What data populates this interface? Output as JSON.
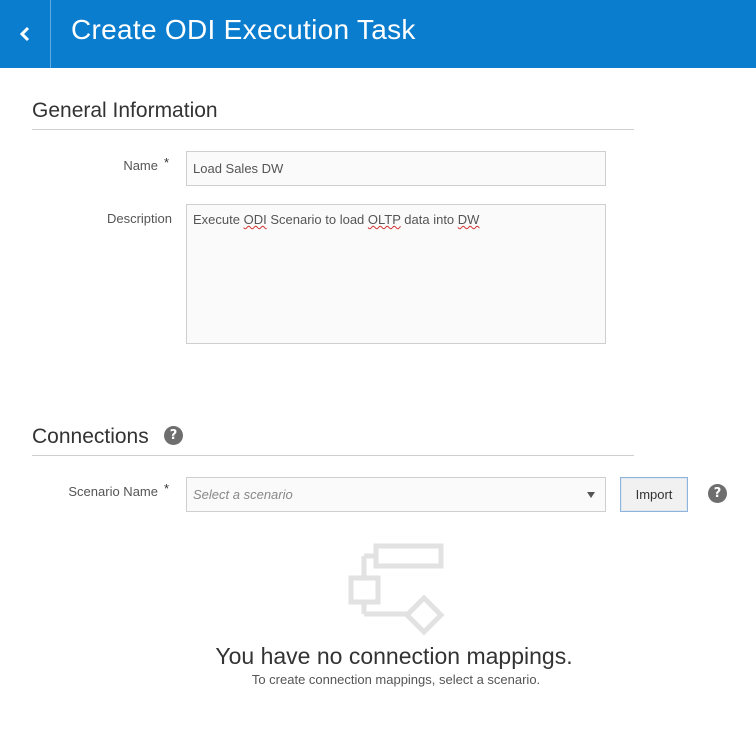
{
  "header": {
    "title": "Create ODI Execution Task",
    "back_icon": "chevron-left-icon",
    "background_color": "#0b7dcf"
  },
  "general_information": {
    "section_title": "General Information",
    "name_label": "Name",
    "name_required_marker": "*",
    "name_value": "Load Sales DW",
    "description_label": "Description",
    "description_segments": [
      {
        "text": "Execute ",
        "squiggle": false
      },
      {
        "text": "ODI",
        "squiggle": true
      },
      {
        "text": " Scenario to load ",
        "squiggle": false
      },
      {
        "text": "OLTP",
        "squiggle": true
      },
      {
        "text": " data into ",
        "squiggle": false
      },
      {
        "text": "DW",
        "squiggle": true
      }
    ]
  },
  "connections": {
    "section_title": "Connections",
    "help_icon": "question-circle-icon",
    "scenario_label": "Scenario Name",
    "scenario_required_marker": "*",
    "scenario_placeholder": "Select a scenario",
    "import_label": "Import",
    "empty_state": {
      "icon": "flow-diagram-icon",
      "title": "You have no connection mappings.",
      "subtitle": "To create connection mappings, select a scenario."
    }
  }
}
